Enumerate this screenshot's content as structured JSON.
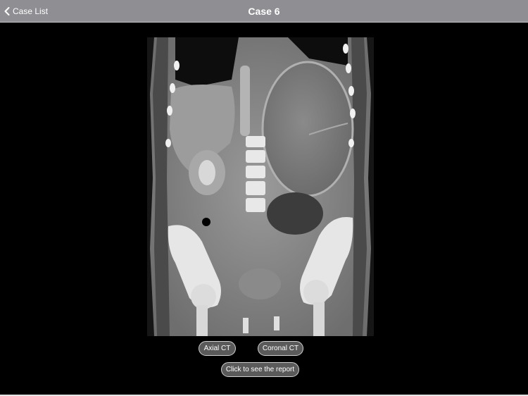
{
  "nav": {
    "back_label": "Case List",
    "title": "Case 6"
  },
  "buttons": {
    "axial": "Axial CT",
    "coronal": "Coronal CT",
    "report": "Click to see the report"
  },
  "colors": {
    "nav_bg": "#8e8e93",
    "button_bg": "#5a5a5a",
    "page_bg": "#000000"
  }
}
